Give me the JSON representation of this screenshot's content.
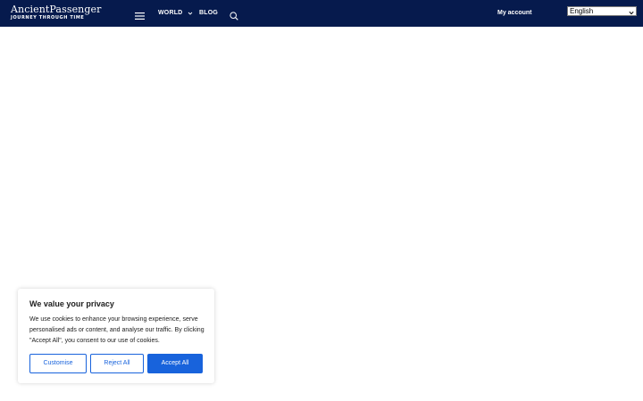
{
  "header": {
    "logo": {
      "title": "AncientPassenger",
      "tagline": "JOURNEY THROUGH TIME"
    },
    "menu_icon": "hamburger-menu-icon",
    "nav": [
      {
        "label": "WORLD",
        "icon": "chevron-down-icon"
      },
      {
        "label": "BLOG"
      }
    ],
    "search_icon": "search-icon",
    "account_label": "My account",
    "language": {
      "selected": "English"
    }
  },
  "cookie_banner": {
    "title": "We value your privacy",
    "text": "We use cookies to enhance your browsing experience, serve personalised ads or content, and analyse our traffic. By clicking \"Accept All\", you consent to our use of cookies.",
    "buttons": {
      "customise": "Customise",
      "reject": "Reject All",
      "accept": "Accept All"
    }
  },
  "colors": {
    "header_bg": "#061a4d",
    "accent": "#1863dc"
  }
}
